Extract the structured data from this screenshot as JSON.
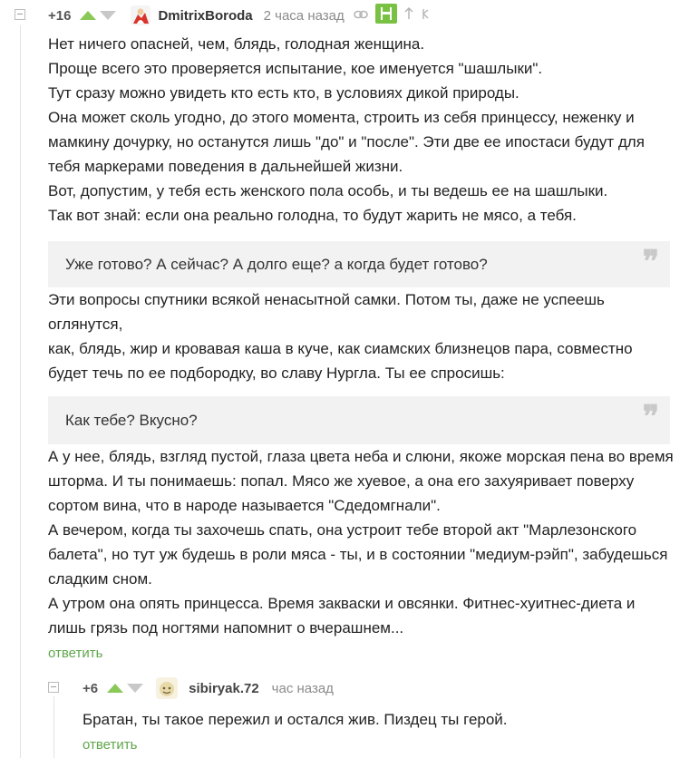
{
  "comment": {
    "rating": "+16",
    "username": "DmitrixBoroda",
    "time": "2 часа назад",
    "paragraphs": [
      "Нет ничего опасней, чем, блядь, голодная женщина.",
      "Проще всего это проверяется испытание, кое именуется \"шашлыки\".",
      "Тут сразу можно увидеть кто есть кто, в условиях дикой природы.",
      "Она может сколь угодно, до этого момента, строить из себя принцессу, неженку и мамкину дочурку, но останутся лишь \"до\" и \"после\". Эти две ее ипостаси будут для тебя маркерами поведения в дальнейшей жизни.",
      "Вот, допустим, у тебя есть женского пола особь, и ты ведешь ее на шашлыки.",
      "Так вот знай: если она реально голодна, то будут жарить не мясо, а тебя."
    ],
    "quote1": "Уже готово? А сейчас? А долго еще? а когда будет готово?",
    "paragraphs2": [
      "Эти вопросы спутники всякой ненасытной самки. Потом ты, даже не успеешь оглянутся,",
      "как, блядь, жир и кровавая каша в куче, как сиамских близнецов пара, совместно будет течь по ее подбородку, во славу Нургла. Ты ее спросишь:"
    ],
    "quote2": "Как тебе? Вкусно?",
    "paragraphs3": [
      "А у нее, блядь, взгляд пустой, глаза цвета неба и слюни, якоже морская пена во время шторма. И ты понимаешь: попал. Мясо же хуевое, а она его захуяривает поверху сортом вина, что в народе называется \"Сдедомгнали\".",
      "А вечером, когда ты захочешь спать, она устроит тебе второй акт \"Марлезонского балета\", но тут уж будешь в роли мяса - ты, и в состоянии \"медиум-рэйп\", забудешься сладким сном.",
      "А утром она опять принцесса. Время закваски и овсянки. Фитнес-хуитнес-диета и лишь грязь под ногтями напомнит о вчерашнем..."
    ],
    "reply_label": "ответить",
    "quote_mark": "❞"
  },
  "reply_comment": {
    "rating": "+6",
    "username": "sibiryak.72",
    "time": "час назад",
    "text": "Братан, ты такое пережил и остался жив. Пиздец ты герой.",
    "reply_label": "ответить"
  },
  "colors": {
    "accent_green": "#8ac858",
    "link_green": "#5fa64b",
    "save_green": "#79c143"
  },
  "icons": [
    "collapse-icon",
    "upvote-icon",
    "downvote-icon",
    "link-icon",
    "save-icon",
    "arrow-up-icon",
    "parent-arrow-icon"
  ]
}
